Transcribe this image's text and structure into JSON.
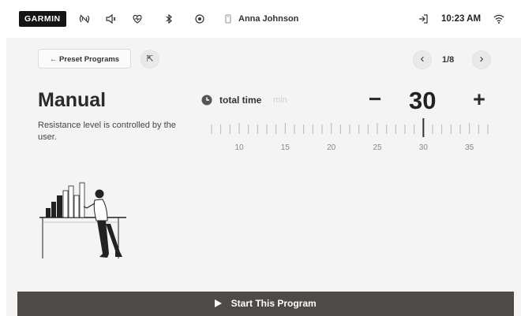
{
  "status_bar": {
    "logo": "GARMIN",
    "user": "Anna Johnson",
    "time": "10:23 AM",
    "icons": [
      "no-wifi-broadcast-icon",
      "volume-icon",
      "heart-rate-icon",
      "bluetooth-icon",
      "target-icon",
      "user-icon",
      "logout-icon",
      "wifi-icon"
    ]
  },
  "nav": {
    "back_label": "Preset Programs",
    "back_arrow": "←",
    "pin_glyph": "⇱",
    "prev_glyph": "‹",
    "next_glyph": "›",
    "page": "1/8"
  },
  "program": {
    "title": "Manual",
    "description": "Resistance level is controlled by the user."
  },
  "total_time": {
    "label": "total time",
    "unit": "min",
    "value": "30",
    "minus": "−",
    "plus": "+",
    "scale_min": 7,
    "scale_max": 37,
    "selected": 30,
    "tick_labels": [
      "10",
      "15",
      "20",
      "25",
      "30",
      "35"
    ]
  },
  "start_button": {
    "icon": "play-icon",
    "label": "Start This Program"
  },
  "colors": {
    "background": "#f4f4f4",
    "button_dark": "#4d4a48",
    "text_dark": "#2a2a2a",
    "muted": "#cfcfcf"
  }
}
